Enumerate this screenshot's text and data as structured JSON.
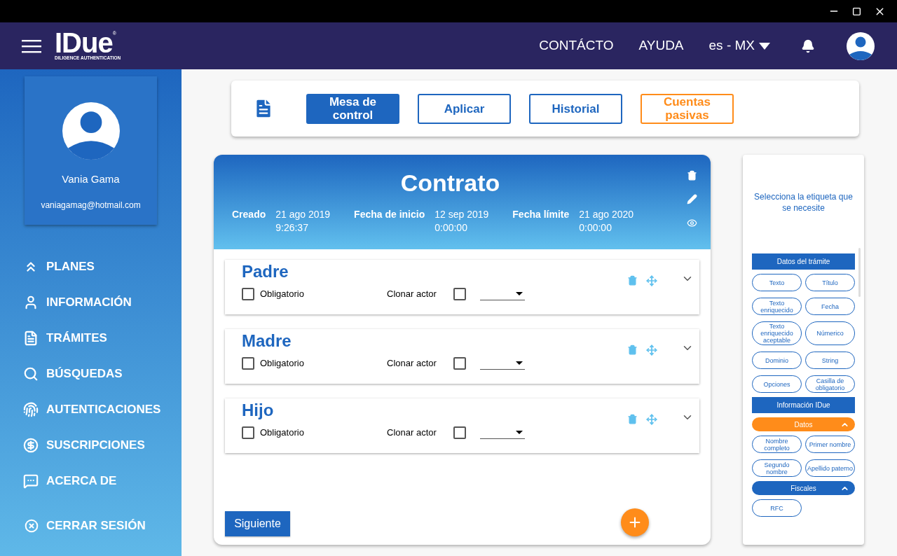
{
  "header": {
    "logo": "IDue",
    "logo_mark": "®",
    "logo_tagline": "DILIGENCE AUTHENTICATION",
    "links": [
      "CONTÁCTO",
      "AYUDA"
    ],
    "language": "es - MX"
  },
  "profile": {
    "name": "Vania Gama",
    "email": "vaniagamag@hotmail.com"
  },
  "sidebar": {
    "items": [
      {
        "label": "PLANES"
      },
      {
        "label": "INFORMACIÓN"
      },
      {
        "label": "TRÁMITES"
      },
      {
        "label": "BÚSQUEDAS"
      },
      {
        "label": "AUTENTICACIONES"
      },
      {
        "label": "SUSCRIPCIONES"
      },
      {
        "label": "ACERCA DE"
      }
    ],
    "logout": "CERRAR SESIÓN"
  },
  "toolbar": {
    "buttons": [
      {
        "label": "Mesa de control",
        "kind": "filled"
      },
      {
        "label": "Aplicar",
        "kind": "outline"
      },
      {
        "label": "Historial",
        "kind": "outline"
      },
      {
        "label": "Cuentas pasivas",
        "kind": "accent"
      }
    ]
  },
  "contract": {
    "title": "Contrato",
    "fields": [
      {
        "label": "Creado",
        "date": "21 ago 2019",
        "time": "9:26:37"
      },
      {
        "label": "Fecha de inicio",
        "date": "12 sep 2019",
        "time": "0:00:00"
      },
      {
        "label": "Fecha límite",
        "date": "21 ago 2020",
        "time": "0:00:00"
      }
    ],
    "actors": [
      {
        "name": "Padre",
        "required_label": "Obligatorio",
        "required": false,
        "clone_label": "Clonar actor",
        "clone": false
      },
      {
        "name": "Madre",
        "required_label": "Obligatorio",
        "required": false,
        "clone_label": "Clonar actor",
        "clone": false
      },
      {
        "name": "Hijo",
        "required_label": "Obligatorio",
        "required": false,
        "clone_label": "Clonar actor",
        "clone": false
      }
    ],
    "next_button": "Siguiente"
  },
  "tag_panel": {
    "title": "Selecciona la etiqueta que se necesite",
    "sections": [
      {
        "kind": "header",
        "label": "Datos del trámite",
        "tags": [
          "Texto",
          "Título",
          "Texto enriquecido",
          "Fecha",
          "Texto enriquecido aceptable",
          "Númerico",
          "Dominio",
          "String",
          "Opciones",
          "Casilla de obligatorio"
        ]
      },
      {
        "kind": "header",
        "label": "Información IDue"
      },
      {
        "kind": "group",
        "label": "Datos",
        "color": "#ff8c1a",
        "expanded": true,
        "tags": [
          "Nombre completo",
          "Primer nombre",
          "Segundo nombre",
          "Apellido paterno"
        ]
      },
      {
        "kind": "group",
        "label": "Fiscales",
        "color": "#1e66bf",
        "expanded": true,
        "tags": [
          "RFC"
        ]
      }
    ]
  }
}
